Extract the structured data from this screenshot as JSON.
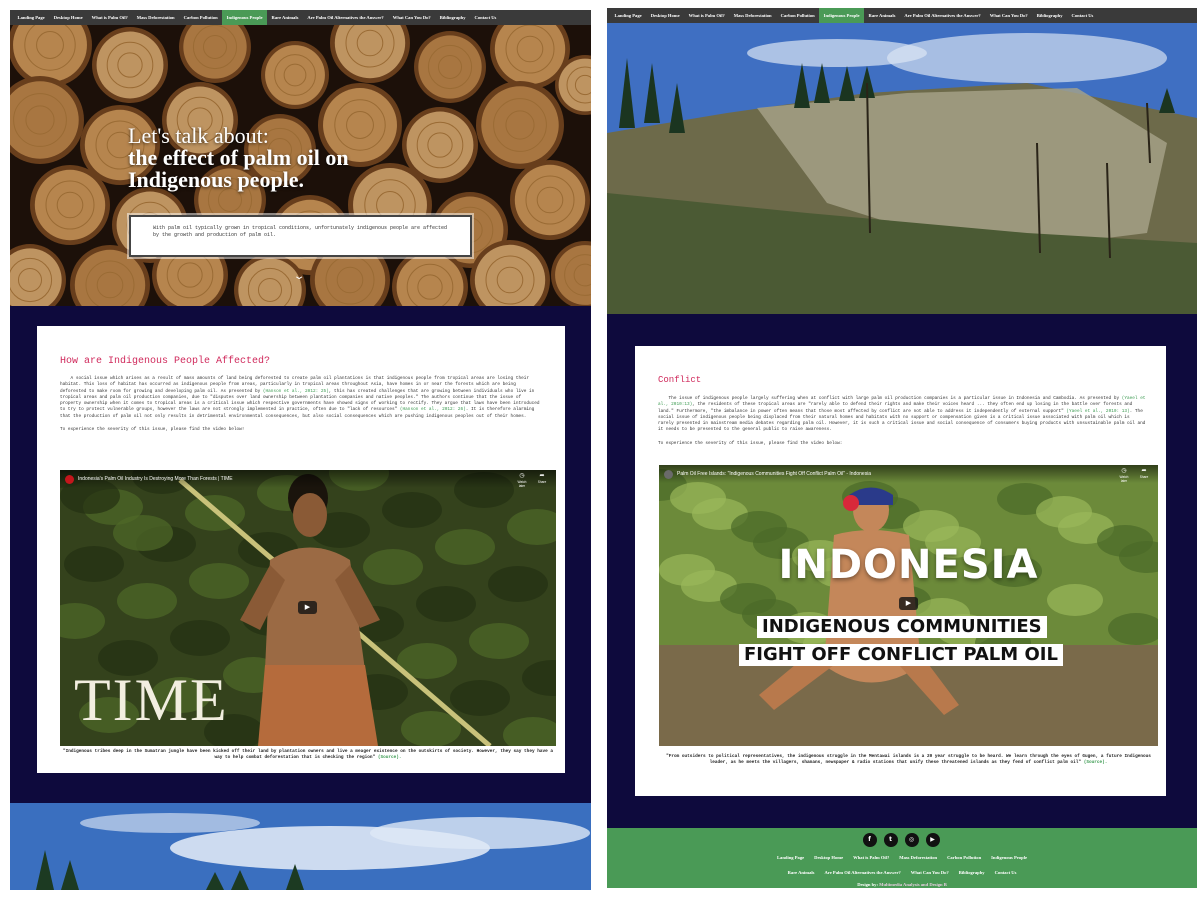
{
  "nav": {
    "items": [
      {
        "label": "Landing Page"
      },
      {
        "label": "Desktop Home"
      },
      {
        "label": "What is Palm Oil?"
      },
      {
        "label": "Mass Deforestation"
      },
      {
        "label": "Carbon Pollution"
      },
      {
        "label": "Indigenous People"
      },
      {
        "label": "Rare Animals"
      },
      {
        "label": "Are Palm Oil Alternatives the Answer?"
      },
      {
        "label": "What Can You Do?"
      },
      {
        "label": "Bibliography"
      },
      {
        "label": "Contact Us"
      }
    ],
    "active_label": "Indigenous People"
  },
  "hero": {
    "title_line1": "Let's talk about:",
    "title_line2": "the effect of palm oil on",
    "title_line3": "Indigenous people.",
    "intro": "With palm oil typically grown in tropical conditions, unfortunately indigenous people are affected by the growth and production of palm oil.",
    "scroll_icon": "chevron-down-icon"
  },
  "left_section": {
    "heading": "How are Indigenous People Affected?",
    "body_1": "A social issue which arises as a result of mass amounts of land being deforested to create palm oil plantations is that indigenous people from tropical areas are losing their habitat. This loss of habitat has occurred as indigenous people from areas, particularly in tropical areas throughout Asia, have homes in or near the forests which are being deforested to make room for growing and developing palm oil. As presented by",
    "cite_1": "(Hanson et al., 2012: 25)",
    "body_2": ", this has created challenges that are growing between individuals who live in tropical areas and palm oil production companies, due to \"disputes over land ownership between plantation companies and native peoples.\" The authors continue that the issue of property ownership when it comes to tropical areas is a critical issue which respective governments have showed signs of working to rectify. They argue that laws have been introduced to try to protect vulnerable groups, however the laws are not strongly implemented in practice, often due to \"lack of resources\"",
    "cite_2": "(Hanson et al., 2012: 26)",
    "body_3": ". It is therefore alarming that the production of palm oil not only results in detrimental environmental consequences, but also social consequences which are pushing indigenous peoples out of their homes.",
    "video_prompt": "To experience the severity of this issue, please find the video below!",
    "video_title": "Indonesia's Palm Oil Industry Is Destroying More Than Forests | TIME",
    "video_watch_later": "Watch later",
    "video_share": "Share",
    "video_brand": "TIME",
    "caption": "\"Indigenous tribes deep in the Sumatran jungle have been kicked off their land by plantation owners and live a meager existence on the outskirts of society. However, they say they have a way to help combat deforestation that is checking the region\"",
    "caption_cite": "(Source)."
  },
  "right_section": {
    "heading": "Conflict",
    "body_1": "The issue of indigenous people largely suffering when at conflict with large palm oil production companies is a particular issue in Indonesia and Cambodia. As presented by",
    "cite_1": "(Yaeel et al., 2010:13)",
    "body_2": ", the residents of these tropical areas are \"rarely able to defend their rights and make their voices heard ... they often end up losing in the battle over forests and land.\" Furthermore, \"the imbalance in power often means that those most affected by conflict are not able to address it independently of external support\"",
    "cite_2": "(Yaeel et al., 2010: 13)",
    "body_3": ". The social issue of indigenous people being displaced from their natural homes and habitats with no support or compensation given is a critical issue associated with palm oil which is rarely presented in mainstream media debates regarding palm oil. However, it is such a critical issue and social consequence of consumers buying products with unsustainable palm oil and it needs to be presented to the general public to raise awareness.",
    "video_prompt": "To experience the severity of this issue, please find the video below:",
    "video_title": "Palm Oil Free Islands: \"Indigenous Communities Fight Off Conflict Palm Oil\" - Indonesia",
    "video_watch_later": "Watch later",
    "video_share": "Share",
    "overlay_big": "INDONESIA",
    "overlay_line1": "INDIGENOUS COMMUNITIES",
    "overlay_line2": "FIGHT OFF CONFLICT PALM OIL",
    "caption": "\"From outsiders to political representatives, the indigenous struggle in the Mentawai islands is a 20 year struggle to be heard. We learn through the eyes of Gugen, a future Indigenous leader, as he meets the villagers, shamans, newspaper & radio stations that unify these threatened islands as they fend of conflict palm oil\"",
    "caption_cite": "(Source)."
  },
  "footer": {
    "social": [
      {
        "icon": "facebook-icon",
        "glyph": "f"
      },
      {
        "icon": "twitter-icon",
        "glyph": "t"
      },
      {
        "icon": "instagram-icon",
        "glyph": "◎"
      },
      {
        "icon": "youtube-icon",
        "glyph": "▶"
      }
    ],
    "row1": [
      "Landing Page",
      "Desktop Home",
      "What is Palm Oil?",
      "Mass Deforestation",
      "Carbon Pollution",
      "Indigenous People"
    ],
    "row2": [
      "Rare Animals",
      "Are Palm Oil Alternatives the Answer?",
      "What Can You Do?",
      "Bibliography",
      "Contact Us"
    ],
    "credit_prefix": "Design by:",
    "credit_name": "Multimedia Analysis and Design B"
  },
  "colors": {
    "nav_bg": "#3a3a3a",
    "nav_active": "#4a9a56",
    "page_bg": "#0e0a3d",
    "heading": "#d02a5c",
    "citation": "#3a9a50",
    "footer_bg": "#4a9a56"
  }
}
